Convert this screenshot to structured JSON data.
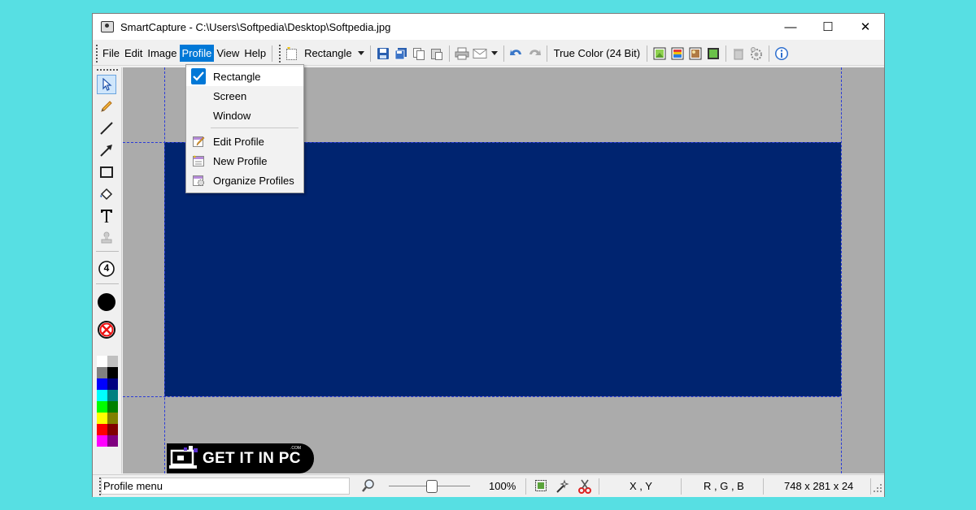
{
  "window": {
    "title": "SmartCapture - C:\\Users\\Softpedia\\Desktop\\Softpedia.jpg",
    "minimize": "—",
    "maximize": "☐",
    "close": "✕"
  },
  "menu": {
    "file": "File",
    "edit": "Edit",
    "image": "Image",
    "profile": "Profile",
    "view": "View",
    "help": "Help"
  },
  "toolbar": {
    "capture_mode": "Rectangle",
    "color_depth": "True Color (24 Bit)",
    "icons": [
      "rectangle-capture-icon",
      "save-icon",
      "save-all-icon",
      "copy-icon",
      "paste-icon",
      "print-icon",
      "email-icon",
      "undo-icon",
      "redo-icon",
      "image-props-icon",
      "palette-icon",
      "picture-icon",
      "frame-icon",
      "trash-icon",
      "settings-icon",
      "info-icon"
    ]
  },
  "profile_menu": {
    "items": [
      {
        "label": "Rectangle",
        "checked": true
      },
      {
        "label": "Screen"
      },
      {
        "label": "Window"
      },
      {
        "label": "Edit Profile",
        "icon": "edit-profile-icon"
      },
      {
        "label": "New Profile",
        "icon": "new-profile-icon"
      },
      {
        "label": "Organize Profiles",
        "icon": "organize-profiles-icon"
      }
    ]
  },
  "tools": {
    "stamp_number": "4",
    "palette": [
      [
        "#ffffff",
        "#c0c0c0"
      ],
      [
        "#808080",
        "#000000"
      ],
      [
        "#0000ff",
        "#000080"
      ],
      [
        "#00ffff",
        "#008080"
      ],
      [
        "#00ff00",
        "#008000"
      ],
      [
        "#ffff00",
        "#808000"
      ],
      [
        "#ff0000",
        "#800000"
      ],
      [
        "#ff00ff",
        "#800080"
      ]
    ]
  },
  "canvas": {
    "fill_color": "#002470",
    "background_color": "#ababab"
  },
  "status": {
    "message": "Profile menu",
    "zoom": "100%",
    "coords": "X , Y",
    "rgb": "R , G , B",
    "dimensions": "748 x 281 x 24"
  },
  "watermark": {
    "text": "GET IT IN PC",
    "suffix": ".COM"
  }
}
